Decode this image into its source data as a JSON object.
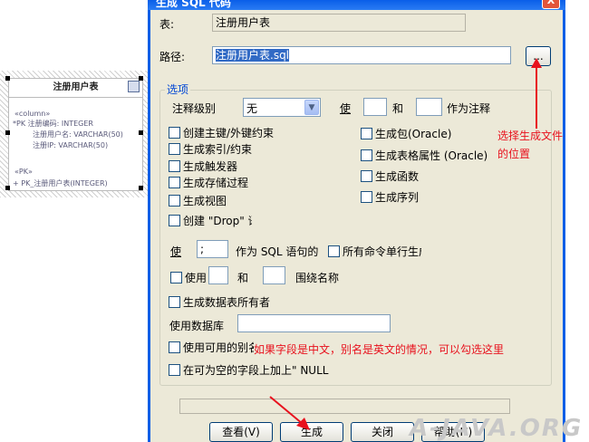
{
  "window": {
    "title": "生成 SQL 代码",
    "close_label": "X"
  },
  "uml": {
    "title": "注册用户表",
    "section1": "«column»",
    "rows": [
      "*PK 注册编码:  INTEGER",
      "注册用户名:  VARCHAR(50)",
      "注册IP:  VARCHAR(50)"
    ],
    "section2": "«PK»",
    "pk_row": "+      PK_注册用户表(INTEGER)"
  },
  "form": {
    "table_label": "表:",
    "table_value": "注册用户表",
    "path_label": "路径:",
    "path_value": "注册用户表.sql",
    "browse_label": "...",
    "group_label": "选项",
    "comment_level_label": "注释级别",
    "comment_level_value": "无",
    "use_label": "使",
    "and_label": "和",
    "as_comment_label": "作为注释",
    "sql_use_label": "使",
    "sql_sep_value": ";",
    "as_sql_stmt_label": "作为 SQL 语句的",
    "use2_label": "使用",
    "and2_label": "和",
    "enclose_label": "围绕名称",
    "use_db_label": "使用数据库"
  },
  "options_left": [
    "创建主键/外键约束",
    "生成索引/约束",
    "生成触发器",
    "生成存储过程",
    "生成视图",
    "创建 \"Drop\" 语句"
  ],
  "options_right": [
    "生成包(Oracle)",
    "生成表格属性 (Oracle)",
    "生成函数",
    "生成序列"
  ],
  "options_more": {
    "all_cmds_single_line": "所有命令单行生成",
    "gen_table_owner": "生成数据表所有者",
    "use_alias": "使用可用的别名",
    "null_on_nullable": "在可为空的字段上加上\" NULL"
  },
  "buttons": {
    "view": "查看(V)",
    "generate": "生成",
    "close": "关闭",
    "help": "帮助(H)"
  },
  "annotations": {
    "path_note_line1": "选择生成文件",
    "path_note_line2": "的位置",
    "alias_note": "如果字段是中文，别名是英文的情况，可以勾选这里"
  },
  "watermark": "A-JAVA.ORG",
  "colors": {
    "title_bar": "#0a5ee8",
    "dialog_bg": "#ece9d8",
    "annotation_red": "#e8111d",
    "group_label_blue": "#0046d5"
  }
}
